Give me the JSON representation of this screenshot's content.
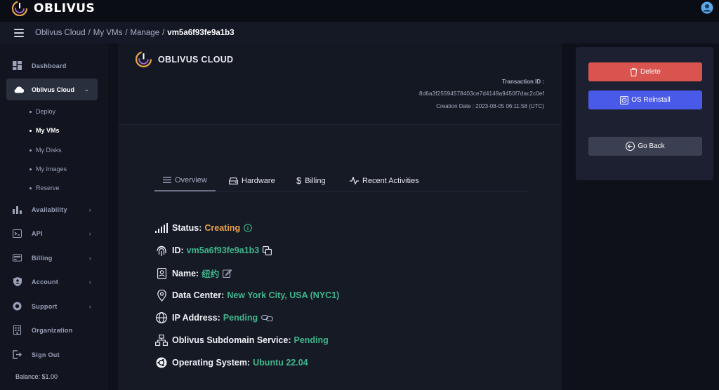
{
  "app": {
    "brand": "OBLIVUS",
    "brand_color": "#e8a24a"
  },
  "breadcrumb": {
    "items": [
      "Oblivus Cloud",
      "My VMs",
      "Manage"
    ],
    "current": "vm5a6f93fe9a1b3"
  },
  "sidebar": {
    "items": [
      {
        "label": "Dashboard",
        "icon": "dashboard-icon"
      },
      {
        "label": "Oblivus Cloud",
        "icon": "cloud-icon",
        "active": true
      },
      {
        "label": "Availability",
        "icon": "bar-chart-icon"
      },
      {
        "label": "API",
        "icon": "terminal-icon"
      },
      {
        "label": "Billing",
        "icon": "billing-icon"
      },
      {
        "label": "Account",
        "icon": "shield-user-icon"
      },
      {
        "label": "Support",
        "icon": "support-icon"
      },
      {
        "label": "Organization",
        "icon": "building-icon"
      },
      {
        "label": "Sign Out",
        "icon": "sign-out-icon"
      }
    ],
    "sub_items": [
      "Deploy",
      "My VMs",
      "My Disks",
      "My Images",
      "Reserve"
    ],
    "balance": "Balance: $1.00"
  },
  "header": {
    "title": "OBLIVUS CLOUD",
    "transaction_label": "Transaction ID :",
    "transaction_id": "8d6a3f25594578403ce7d4149a9450f7dac2c0ef",
    "creation_date": "Creation Date : 2023-08-05 06:11:58 (UTC)"
  },
  "tabs": [
    "Overview",
    "Hardware",
    "Billing",
    "Recent Activities"
  ],
  "details": {
    "status": {
      "label": "Status:",
      "value": "Creating"
    },
    "id": {
      "label": "ID:",
      "value": "vm5a6f93fe9a1b3"
    },
    "name": {
      "label": "Name:",
      "value": "纽约"
    },
    "data_center": {
      "label": "Data Center:",
      "value": "New York City, USA (NYC1)"
    },
    "ip": {
      "label": "IP Address:",
      "value": "Pending"
    },
    "subdomain": {
      "label": "Oblivus Subdomain Service:",
      "value": "Pending"
    },
    "os": {
      "label": "Operating System:",
      "value": "Ubuntu 22.04"
    }
  },
  "actions": {
    "delete": "Delete",
    "reinstall": "OS Reinstall",
    "back": "Go Back"
  },
  "colors": {
    "accent_green": "#3fb68b",
    "status_orange": "#e8a24a",
    "delete_red": "#d9534f",
    "reinstall_blue": "#4a5ae8"
  }
}
